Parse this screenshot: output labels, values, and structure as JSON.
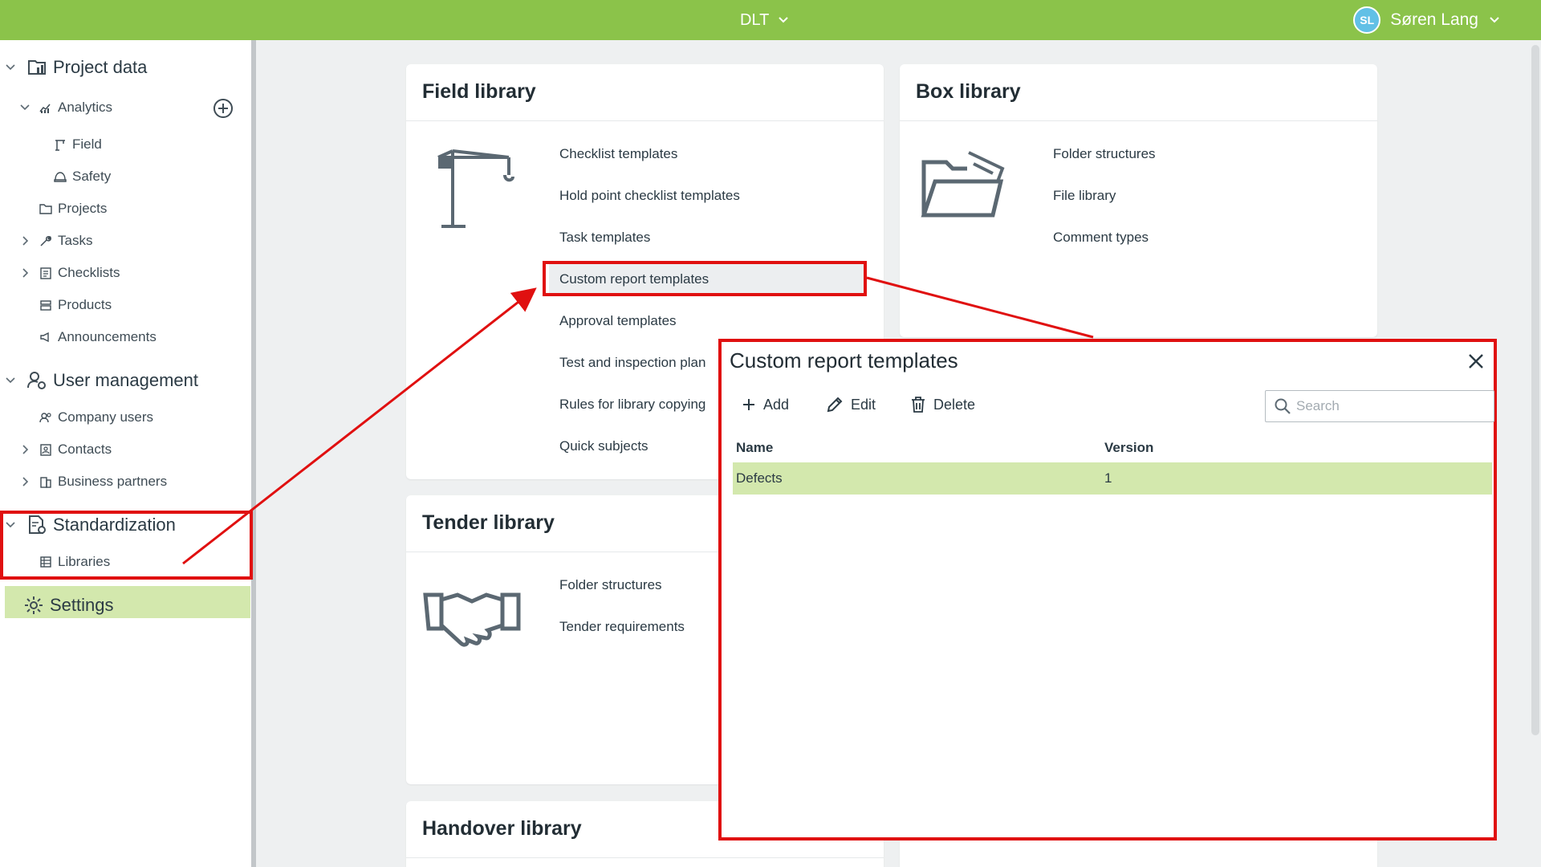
{
  "topbar": {
    "project": "DLT",
    "user_initials": "SL",
    "user_name": "Søren Lang"
  },
  "sidebar": {
    "project_data": "Project data",
    "analytics": "Analytics",
    "field": "Field",
    "safety": "Safety",
    "projects": "Projects",
    "tasks": "Tasks",
    "checklists": "Checklists",
    "products": "Products",
    "announcements": "Announcements",
    "user_management": "User management",
    "company_users": "Company users",
    "contacts": "Contacts",
    "business_partners": "Business partners",
    "standardization": "Standardization",
    "libraries": "Libraries",
    "settings": "Settings"
  },
  "field_library": {
    "title": "Field library",
    "links": [
      "Checklist templates",
      "Hold point checklist templates",
      "Task templates",
      "Custom report templates",
      "Approval templates",
      "Test and inspection plan",
      "Rules for library copying",
      "Quick subjects"
    ]
  },
  "box_library": {
    "title": "Box library",
    "links": [
      "Folder structures",
      "File library",
      "Comment types"
    ]
  },
  "tender_library": {
    "title": "Tender library",
    "links": [
      "Folder structures",
      "Tender requirements"
    ]
  },
  "handover_library": {
    "title": "Handover library"
  },
  "dialog": {
    "title": "Custom report templates",
    "add": "Add",
    "edit": "Edit",
    "delete": "Delete",
    "search_placeholder": "Search",
    "columns": {
      "name": "Name",
      "version": "Version"
    },
    "rows": [
      {
        "name": "Defects",
        "version": "1"
      }
    ]
  },
  "colors": {
    "topbar": "#8bc34a",
    "selected_row": "#d3e8ad",
    "annotation_red": "#e01010"
  }
}
